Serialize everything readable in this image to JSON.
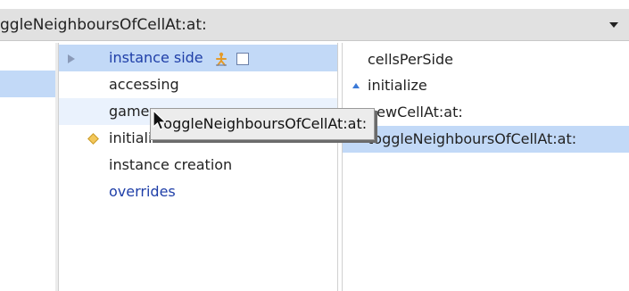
{
  "header": {
    "title": "ggleNeighboursOfCellAt:at:",
    "dropdown_icon": "chevron-down-icon"
  },
  "protocols": {
    "items": [
      {
        "label": "instance side",
        "color": "#1f3fa8",
        "selected": true
      },
      {
        "label": "accessing",
        "color": "#222222"
      },
      {
        "label": "game",
        "color": "#222222"
      },
      {
        "label": "initialization",
        "color": "#222222"
      },
      {
        "label": "instance creation",
        "color": "#222222"
      },
      {
        "label": "overrides",
        "color": "#1f3fa8"
      }
    ]
  },
  "methods": {
    "items": [
      {
        "label": "cellsPerSide"
      },
      {
        "label": "initialize"
      },
      {
        "label": "newCellAt:at:"
      },
      {
        "label": "toggleNeighboursOfCellAt:at:",
        "selected": true
      }
    ]
  },
  "tooltip": {
    "text": "toggleNeighboursOfCellAt:at:"
  },
  "colors": {
    "selection": "#c2d9f7",
    "accent": "#3b7ad8"
  }
}
